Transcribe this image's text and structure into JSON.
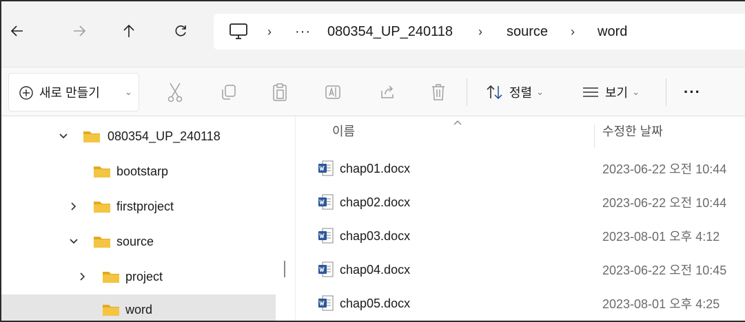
{
  "nav": {
    "back_icon": "arrow-left-icon",
    "forward_icon": "arrow-right-icon",
    "up_icon": "arrow-up-icon",
    "refresh_icon": "refresh-icon",
    "computer_icon": "monitor-icon",
    "more_crumbs": "···",
    "breadcrumb": [
      "080354_UP_240118",
      "source",
      "word"
    ]
  },
  "commands": {
    "new_label": "새로 만들기",
    "sort_label": "정렬",
    "view_label": "보기",
    "more_label": "···"
  },
  "tree": {
    "items": [
      {
        "label": "080354_UP_240118",
        "state": "expanded"
      },
      {
        "label": "bootstarp",
        "state": "leaf"
      },
      {
        "label": "firstproject",
        "state": "collapsed"
      },
      {
        "label": "source",
        "state": "expanded"
      },
      {
        "label": "project",
        "state": "collapsed"
      },
      {
        "label": "word",
        "state": "leaf",
        "selected": true
      }
    ]
  },
  "list": {
    "columns": {
      "name": "이름",
      "modified": "수정한 날짜"
    },
    "files": [
      {
        "name": "chap01.docx",
        "modified": "2023-06-22 오전 10:44"
      },
      {
        "name": "chap02.docx",
        "modified": "2023-06-22 오전 10:44"
      },
      {
        "name": "chap03.docx",
        "modified": "2023-08-01 오후 4:12"
      },
      {
        "name": "chap04.docx",
        "modified": "2023-06-22 오전 10:45"
      },
      {
        "name": "chap05.docx",
        "modified": "2023-08-01 오후 4:25"
      }
    ]
  },
  "colors": {
    "folder": "#f4c542",
    "folder_dark": "#e1ab1c",
    "word_blue": "#2b579a",
    "selected_row": "#e5e5e5",
    "address_bg": "#f3f3f3"
  }
}
